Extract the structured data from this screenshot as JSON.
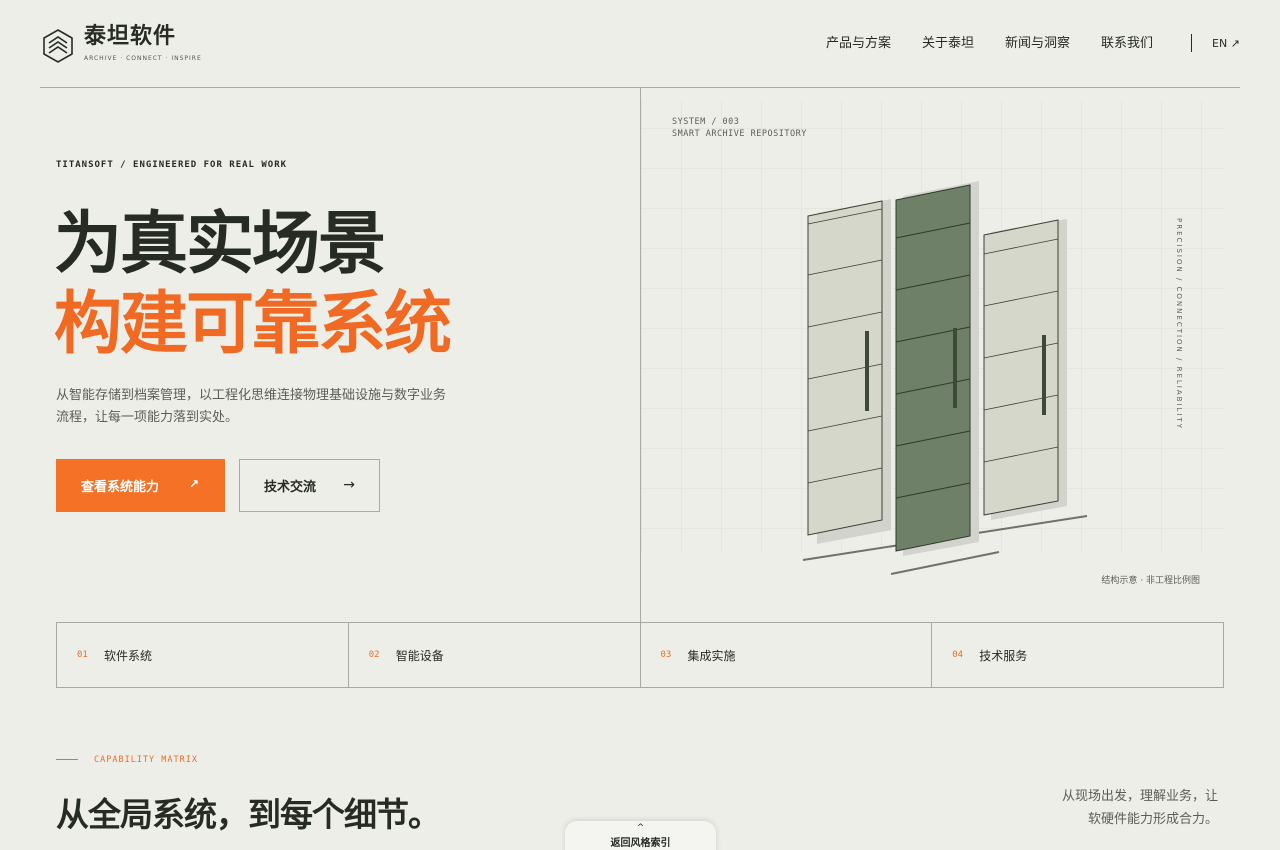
{
  "brand": {
    "name": "泰坦软件",
    "tagline": "ARCHIVE · CONNECT · INSPIRE"
  },
  "nav": {
    "items": [
      "产品与方案",
      "关于泰坦",
      "新闻与洞察",
      "联系我们"
    ],
    "lang": "EN ↗"
  },
  "hero": {
    "eyebrow": "TITANSOFT / ENGINEERED FOR REAL WORK",
    "title_line1": "为真实场景",
    "title_line2": "构建可靠系统",
    "description": "从智能存储到档案管理，以工程化思维连接物理基础设施与数字业务流程，让每一项能力落到实处。",
    "primary_button": "查看系统能力",
    "primary_arrow": "↗",
    "secondary_button": "技术交流",
    "secondary_arrow": "→"
  },
  "panel": {
    "code_line1": "SYSTEM / 003",
    "code_line2": "SMART ARCHIVE REPOSITORY",
    "vertical_text": "PRECISION / CONNECTION / RELIABILITY",
    "note": "结构示意 · 非工程比例图"
  },
  "categories": [
    {
      "num": "01",
      "label": "软件系统"
    },
    {
      "num": "02",
      "label": "智能设备"
    },
    {
      "num": "03",
      "label": "集成实施"
    },
    {
      "num": "04",
      "label": "技术服务"
    }
  ],
  "capability": {
    "eyebrow": "CAPABILITY MATRIX",
    "title": "从全局系统，到每个细节。",
    "side_text": "从现场出发，理解业务，让软硬件能力形成合力。"
  },
  "back_pill": {
    "chevron": "^",
    "label": "返回风格索引"
  },
  "colors": {
    "background": "#eeeee8",
    "accent": "#f47125",
    "text": "#262b24",
    "cabinet_dark": "#6f8068",
    "cabinet_light": "#d4d7c9"
  }
}
